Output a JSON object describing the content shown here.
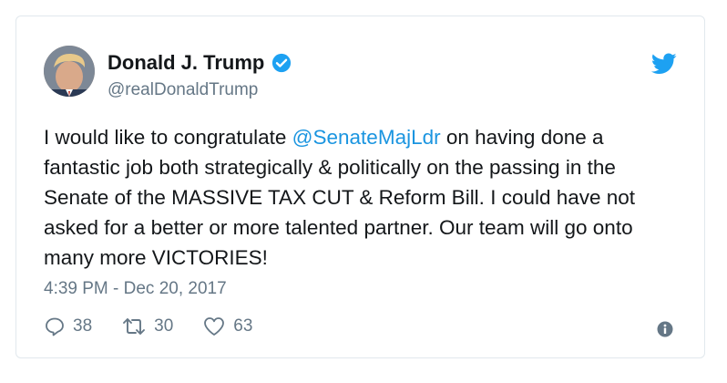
{
  "colors": {
    "text_primary": "#14171a",
    "text_secondary": "#657786",
    "link": "#1b95e0",
    "twitter_blue": "#1da1f2",
    "border": "#e1e8ed"
  },
  "author": {
    "display_name": "Donald J. Trump",
    "handle": "@realDonaldTrump",
    "verified": true,
    "avatar_icon": "profile-photo"
  },
  "tweet": {
    "text_before_mention": "I would like to congratulate ",
    "mention": "@SenateMajLdr",
    "text_after_mention": " on having done a fantastic job both strategically & politically on the passing in the Senate of the MASSIVE TAX CUT & Reform Bill. I could have not asked for a better or more talented partner. Our team will go onto many more VICTORIES!",
    "timestamp": "4:39 PM - Dec 20, 2017"
  },
  "actions": {
    "replies": "38",
    "retweets": "30",
    "likes": "63"
  },
  "icons": {
    "brand": "twitter-bird-icon",
    "reply": "reply-icon",
    "retweet": "retweet-icon",
    "like": "heart-icon",
    "info": "info-icon",
    "verified": "verified-badge-icon"
  }
}
